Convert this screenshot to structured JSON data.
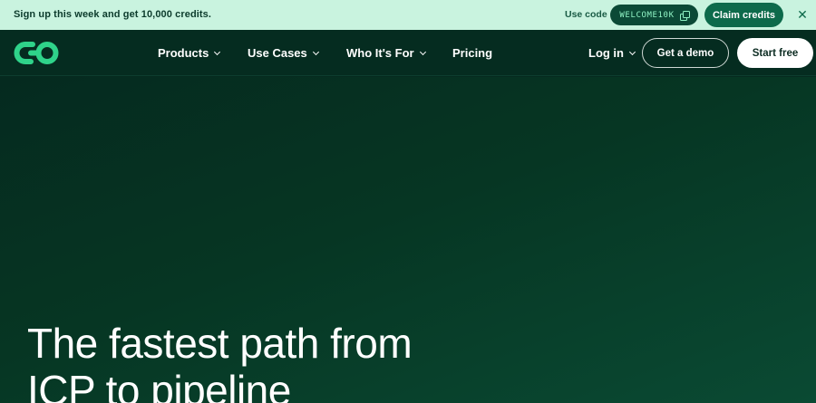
{
  "promo": {
    "text": "Sign up this week and get 10,000 credits.",
    "use_code_label": "Use code",
    "code": "WELCOME10K",
    "claim_label": "Claim credits",
    "close_glyph": "✕"
  },
  "nav": {
    "items": [
      {
        "label": "Products",
        "has_dropdown": true
      },
      {
        "label": "Use Cases",
        "has_dropdown": true
      },
      {
        "label": "Who It's For",
        "has_dropdown": true
      },
      {
        "label": "Pricing",
        "has_dropdown": false
      }
    ],
    "login_label": "Log in",
    "demo_label": "Get a demo",
    "start_label": "Start free"
  },
  "hero": {
    "title_line1": "The fastest path from",
    "title_line2": "ICP to pipeline"
  },
  "colors": {
    "banner_bg": "#c9f3df",
    "accent": "#0d6a4b",
    "code_text": "#8ff2c4",
    "nav_bg": "#052c20",
    "logo": "#2fd38a"
  },
  "icons": {
    "logo": "linked-loops-logo-icon",
    "copy": "copy-icon",
    "close": "close-icon",
    "dropdown": "chevron-down-icon"
  }
}
